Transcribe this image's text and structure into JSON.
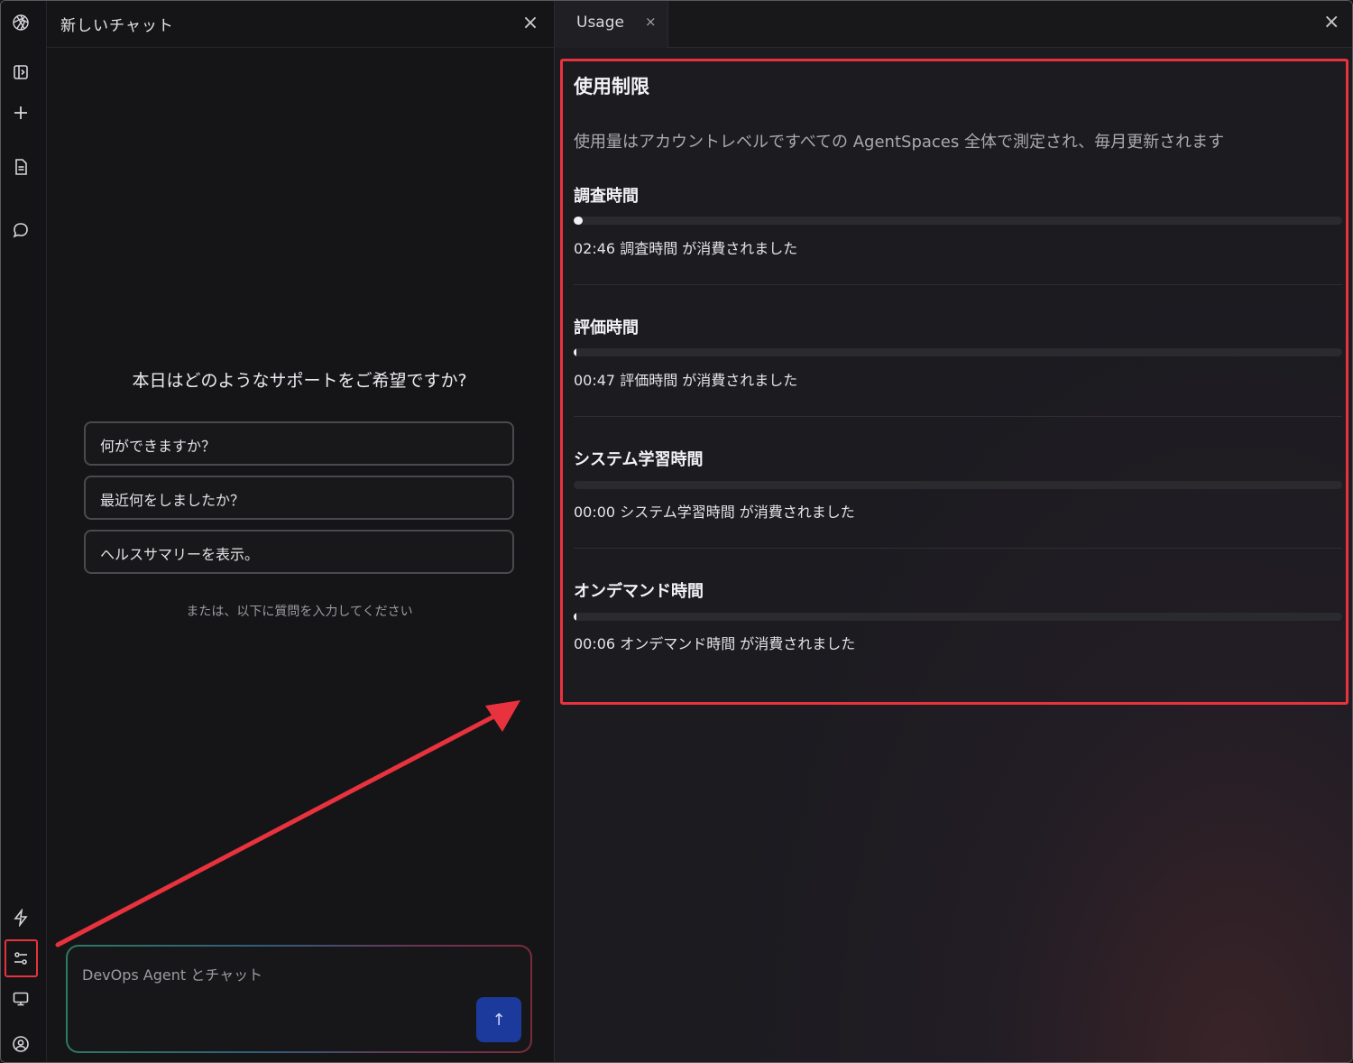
{
  "colors": {
    "highlight": "#e8323e",
    "send_button": "#1c3a9c",
    "background": "#161618"
  },
  "rail": {
    "icons": [
      "logo-icon",
      "sidebar-toggle-icon",
      "plus-icon",
      "document-icon",
      "chat-bubble-icon",
      "lightning-icon",
      "sliders-icon",
      "monitor-icon",
      "user-circle-icon"
    ]
  },
  "chat": {
    "title": "新しいチャット",
    "close": "×",
    "greeting": "本日はどのようなサポートをご希望ですか?",
    "suggestions": [
      "何ができますか？",
      "最近何をしましたか？",
      "ヘルスサマリーを表示。"
    ],
    "hint": "または、以下に質問を入力してください",
    "input_placeholder": "DevOps Agent とチャット",
    "send_icon": "↑"
  },
  "usage": {
    "tab_label": "Usage",
    "tab_close": "×",
    "panel_close": "×",
    "title": "使用制限",
    "description": "使用量はアカウントレベルですべての AgentSpaces 全体で測定され、毎月更新されます",
    "metrics": [
      {
        "title": "調査時間",
        "text": "02:46 調査時間 が消費されました",
        "fraction": 0.012
      },
      {
        "title": "評価時間",
        "text": "00:47 評価時間 が消費されました",
        "fraction": 0.004
      },
      {
        "title": "システム学習時間",
        "text": "00:00 システム学習時間 が消費されました",
        "fraction": 0
      },
      {
        "title": "オンデマンド時間",
        "text": "00:06 オンデマンド時間 が消費されました",
        "fraction": 0.001
      }
    ]
  }
}
